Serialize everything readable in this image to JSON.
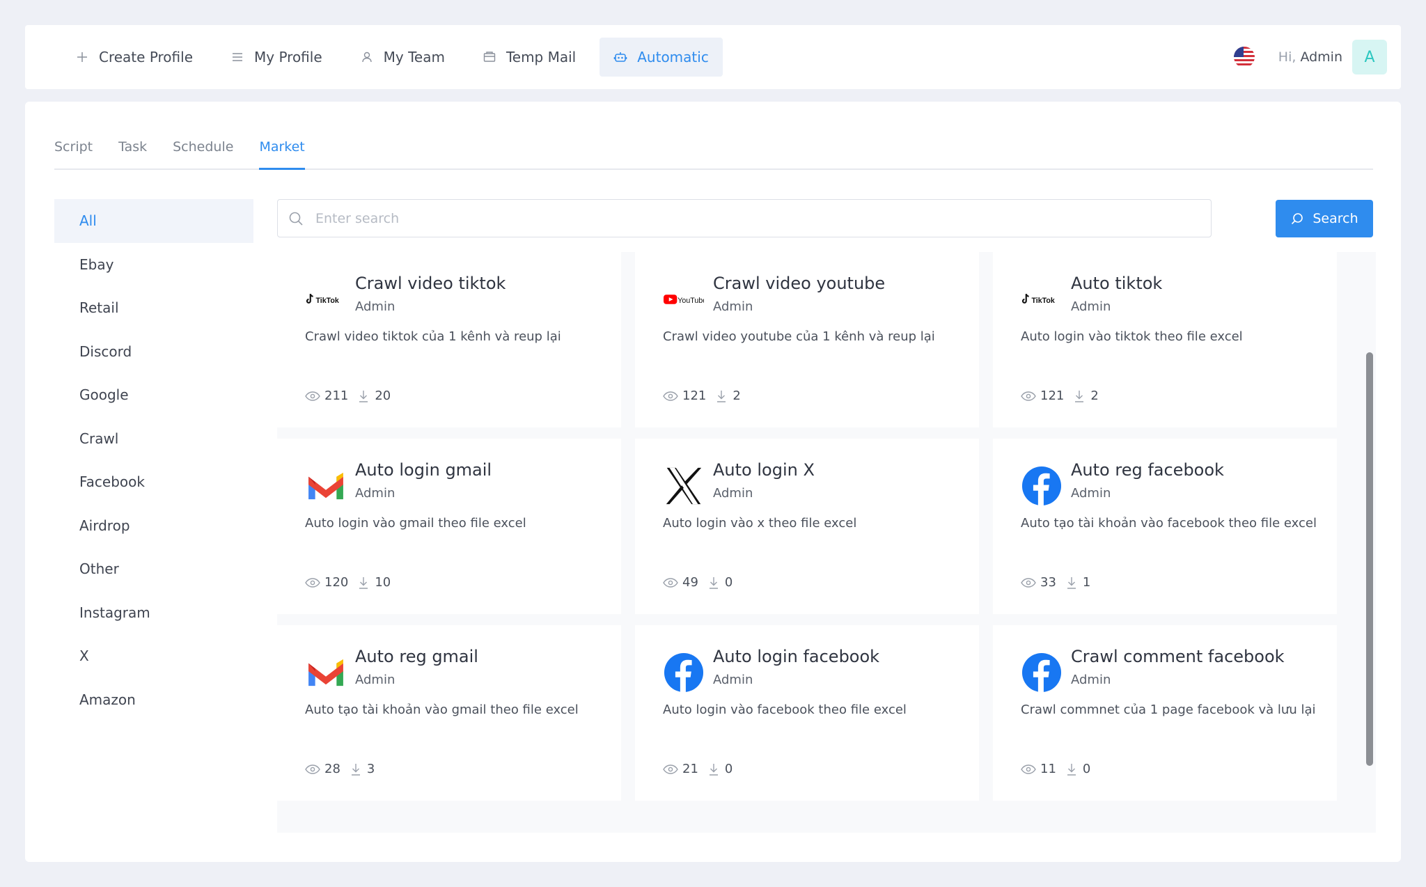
{
  "nav": {
    "items": [
      {
        "label": "Create Profile",
        "icon": "plus-icon"
      },
      {
        "label": "My Profile",
        "icon": "list-icon"
      },
      {
        "label": "My Team",
        "icon": "user-icon"
      },
      {
        "label": "Temp Mail",
        "icon": "mail-icon"
      },
      {
        "label": "Automatic",
        "icon": "robot-icon",
        "active": true
      }
    ],
    "greeting_prefix": "Hi,",
    "user_name": "Admin",
    "avatar_letter": "A",
    "flag": "us-flag-icon"
  },
  "subtabs": [
    {
      "label": "Script"
    },
    {
      "label": "Task"
    },
    {
      "label": "Schedule"
    },
    {
      "label": "Market",
      "active": true
    }
  ],
  "categories": [
    "All",
    "Ebay",
    "Retail",
    "Discord",
    "Google",
    "Crawl",
    "Facebook",
    "Airdrop",
    "Other",
    "Instagram",
    "X",
    "Amazon"
  ],
  "active_category": "All",
  "search": {
    "placeholder": "Enter search",
    "button_label": "Search"
  },
  "cards": [
    {
      "title": "Crawl video tiktok",
      "author": "Admin",
      "description": "Crawl video tiktok của 1 kênh và reup lại",
      "views": "211",
      "downloads": "20",
      "logo": "tiktok-logo",
      "logo_text": "TikTok"
    },
    {
      "title": "Crawl video youtube",
      "author": "Admin",
      "description": "Crawl video youtube của 1 kênh và reup lại",
      "views": "121",
      "downloads": "2",
      "logo": "youtube-logo",
      "logo_text": "YouTube"
    },
    {
      "title": "Auto tiktok",
      "author": "Admin",
      "description": "Auto login vào tiktok theo file excel",
      "views": "121",
      "downloads": "2",
      "logo": "tiktok-logo",
      "logo_text": "TikTok"
    },
    {
      "title": "Auto login gmail",
      "author": "Admin",
      "description": "Auto login vào gmail theo file excel",
      "views": "120",
      "downloads": "10",
      "logo": "gmail-logo"
    },
    {
      "title": "Auto login X",
      "author": "Admin",
      "description": "Auto login vào x theo file excel",
      "views": "49",
      "downloads": "0",
      "logo": "x-logo"
    },
    {
      "title": "Auto reg facebook",
      "author": "Admin",
      "description": "Auto tạo tài khoản vào facebook theo file excel",
      "views": "33",
      "downloads": "1",
      "logo": "facebook-logo"
    },
    {
      "title": "Auto reg gmail",
      "author": "Admin",
      "description": "Auto tạo tài khoản vào gmail theo file excel",
      "views": "28",
      "downloads": "3",
      "logo": "gmail-logo"
    },
    {
      "title": "Auto login facebook",
      "author": "Admin",
      "description": "Auto login vào facebook theo file excel",
      "views": "21",
      "downloads": "0",
      "logo": "facebook-logo"
    },
    {
      "title": "Crawl comment facebook",
      "author": "Admin",
      "description": "Crawl commnet của 1 page facebook và lưu lại",
      "views": "11",
      "downloads": "0",
      "logo": "facebook-logo"
    }
  ],
  "colors": {
    "accent": "#2f8cee",
    "background": "#eef0f6",
    "avatar_bg": "#d7f5f3",
    "avatar_text": "#2cc7c0"
  }
}
